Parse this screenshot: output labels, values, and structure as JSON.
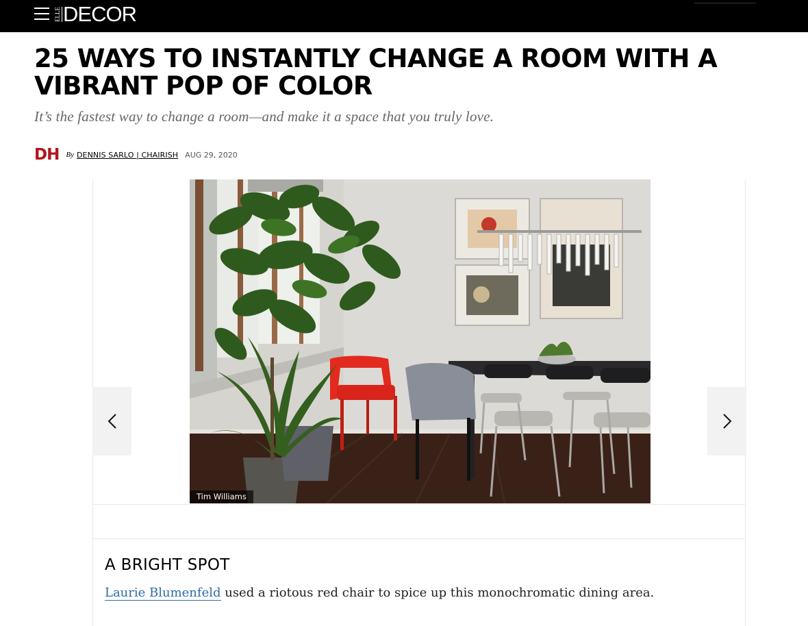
{
  "header": {
    "menu_icon": "hamburger-menu-icon",
    "logo_small": "ELLE",
    "logo_main": "DECOR",
    "background_color": "#000000"
  },
  "article": {
    "headline": "25 WAYS TO INSTANTLY CHANGE A ROOM WITH A VIBRANT POP OF COLOR",
    "dek": "It’s the fastest way to change a room—and make it a space that you truly love.",
    "author_initials": "DH",
    "author_initials_color": "#b1151c",
    "by_label": "By",
    "author": "DENNIS SARLO | CHAIRISH",
    "date": "AUG 29, 2020"
  },
  "slideshow": {
    "photo_credit": "Tim Williams",
    "prev_icon": "chevron-left-icon",
    "next_icon": "chevron-right-icon",
    "slide_title": "A BRIGHT SPOT",
    "caption_link": "Laurie Blumenfeld",
    "caption_rest": " used a riotous red chair to spice up this monochromatic dining area.",
    "link_color": "#2d6aa8"
  }
}
